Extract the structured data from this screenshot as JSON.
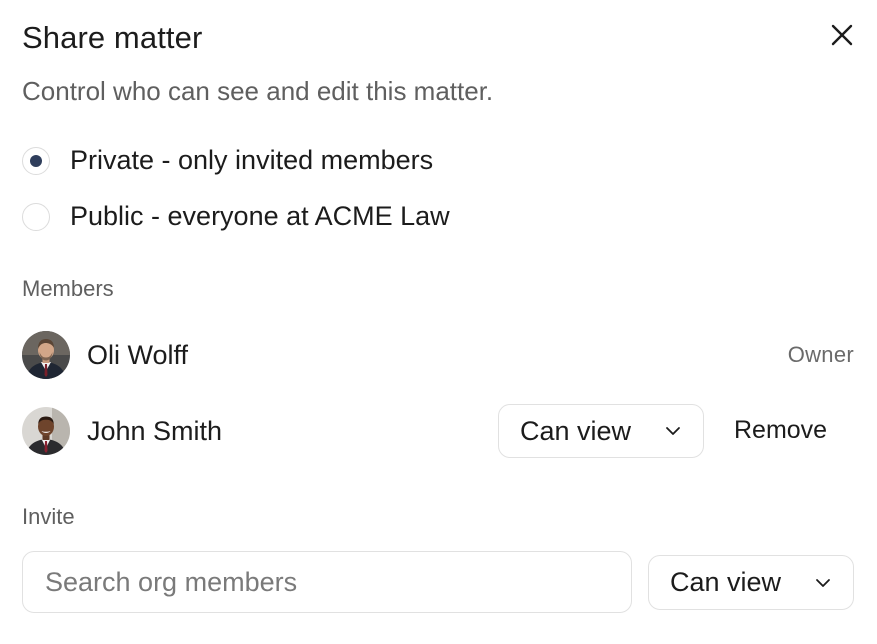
{
  "dialog": {
    "title": "Share matter",
    "subtitle": "Control who can see and edit this matter.",
    "close_icon": "close-icon"
  },
  "visibility": {
    "options": [
      {
        "label": "Private - only invited members",
        "selected": true
      },
      {
        "label": "Public - everyone at ACME Law",
        "selected": false
      }
    ],
    "accent_color": "#2f3e5c"
  },
  "members": {
    "label": "Members",
    "list": [
      {
        "name": "Oli Wolff",
        "role": "Owner"
      },
      {
        "name": "John Smith",
        "permission": "Can view",
        "remove_label": "Remove"
      }
    ]
  },
  "invite": {
    "label": "Invite",
    "search_placeholder": "Search org members",
    "permission": "Can view"
  }
}
